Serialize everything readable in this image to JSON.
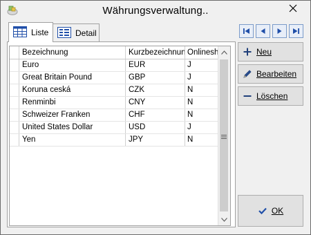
{
  "window": {
    "title": "Währungsverwaltung.."
  },
  "tabs": [
    {
      "label": "Liste",
      "active": true
    },
    {
      "label": "Detail",
      "active": false
    }
  ],
  "grid": {
    "columns": [
      "Bezeichnung",
      "Kurzbezeichnung",
      "Onlineshop"
    ],
    "rows": [
      {
        "bezeichnung": "Euro",
        "kurz": "EUR",
        "shop": "J"
      },
      {
        "bezeichnung": "Great Britain Pound",
        "kurz": "GBP",
        "shop": "J"
      },
      {
        "bezeichnung": "Koruna ceská",
        "kurz": "CZK",
        "shop": "N"
      },
      {
        "bezeichnung": "Renminbi",
        "kurz": "CNY",
        "shop": "N"
      },
      {
        "bezeichnung": "Schweizer Franken",
        "kurz": "CHF",
        "shop": "N"
      },
      {
        "bezeichnung": "United States Dollar",
        "kurz": "USD",
        "shop": "J"
      },
      {
        "bezeichnung": "Yen",
        "kurz": "JPY",
        "shop": "N"
      }
    ]
  },
  "actions": {
    "new_label": "Neu",
    "edit_label": "Bearbeiten",
    "delete_label": "Löschen",
    "ok_label": "OK"
  },
  "icons": {
    "app": "app-icon",
    "close": "close-icon",
    "list_tab": "grid-list-icon",
    "detail_tab": "detail-form-icon",
    "nav_first": "first-record-icon",
    "nav_prev": "previous-record-icon",
    "nav_next": "next-record-icon",
    "nav_last": "last-record-icon",
    "new": "plus-icon",
    "edit": "pencil-icon",
    "delete": "minus-icon",
    "ok": "checkmark-icon"
  },
  "colors": {
    "nav_accent": "#1f4ea8",
    "window_bg": "#f0f0f0"
  }
}
